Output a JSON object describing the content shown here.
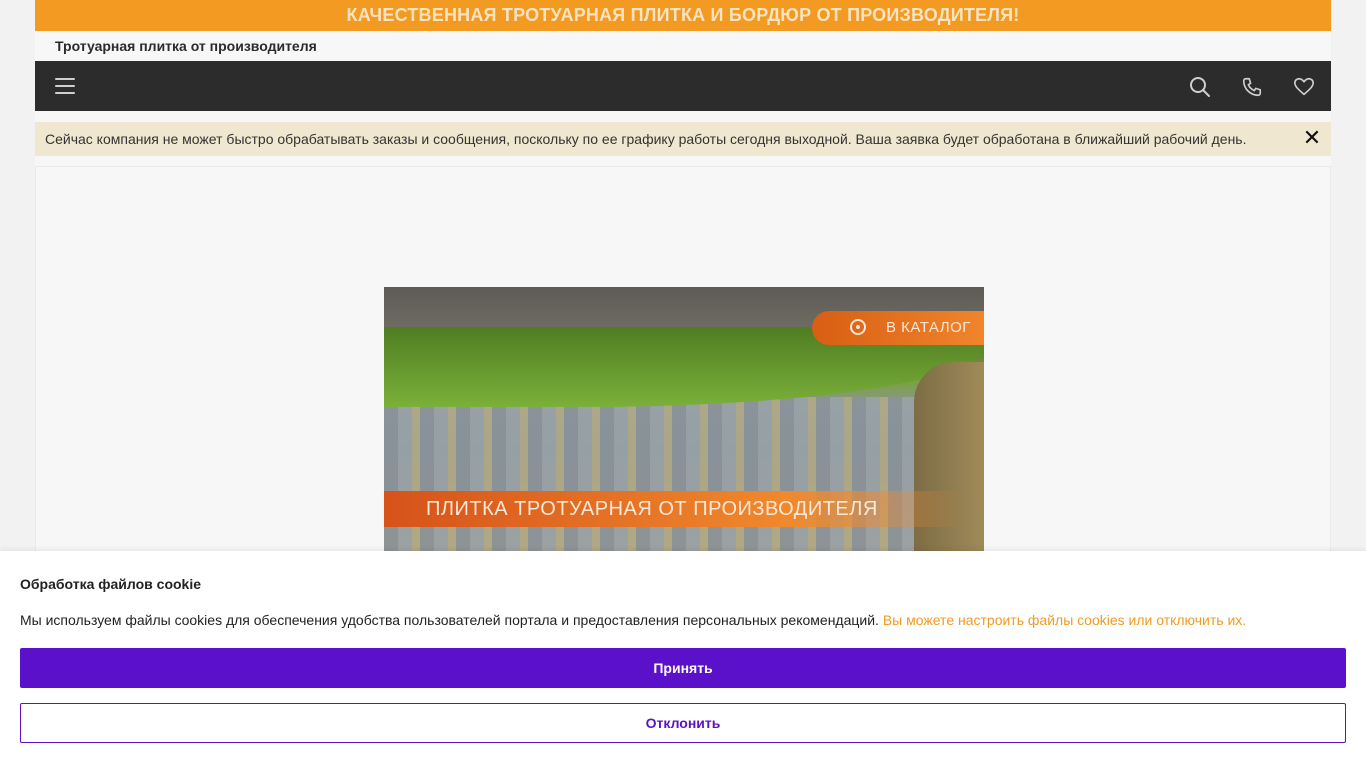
{
  "header": {
    "banner": "КАЧЕСТВЕННАЯ ТРОТУАРНАЯ ПЛИТКА И БОРДЮР ОТ ПРОИЗВОДИТЕЛЯ!",
    "site_title": "Тротуарная плитка от производителя"
  },
  "navbar": {
    "icons": [
      "menu-icon",
      "search-icon",
      "phone-icon",
      "heart-icon"
    ]
  },
  "notice": {
    "text": "Сейчас компания не может быстро обрабатывать заказы и сообщения, поскольку по ее графику работы сегодня выходной. Ваша заявка будет обработана в ближайший рабочий день.",
    "close": "✕"
  },
  "hero": {
    "catalog_label": "В КАТАЛОГ",
    "caption": "ПЛИТКА ТРОТУАРНАЯ ОТ ПРОИЗВОДИТЕЛЯ"
  },
  "cookie": {
    "title": "Обработка файлов cookie",
    "text": "Мы используем файлы cookies для обеспечения удобства пользователей портала и предоставления персональных рекомендаций.",
    "link": "Вы можете настроить файлы cookies или отключить их.",
    "accept": "Принять",
    "decline": "Отклонить"
  },
  "colors": {
    "accent": "#f29a21",
    "navbar": "#2c2c2c",
    "button": "#5b10c9"
  }
}
